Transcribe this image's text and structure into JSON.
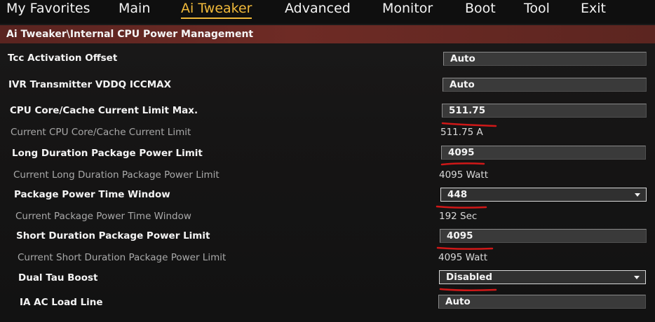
{
  "nav": {
    "items": [
      {
        "label": "My Favorites"
      },
      {
        "label": "Main"
      },
      {
        "label": "Ai Tweaker"
      },
      {
        "label": "Advanced"
      },
      {
        "label": "Monitor"
      },
      {
        "label": "Boot"
      },
      {
        "label": "Tool"
      },
      {
        "label": "Exit"
      }
    ],
    "active": "Ai Tweaker"
  },
  "breadcrumb": "Ai Tweaker\\Internal CPU Power Management",
  "settings": {
    "tcc_activation_offset": {
      "label": "Tcc Activation Offset",
      "value": "Auto"
    },
    "ivr_transmitter": {
      "label": "IVR Transmitter VDDQ ICCMAX",
      "value": "Auto"
    },
    "cpu_core_cache_limit": {
      "label": "CPU Core/Cache Current Limit Max.",
      "value": "511.75"
    },
    "current_cpu_core_cache_limit": {
      "label": "Current CPU Core/Cache Current Limit",
      "value": "511.75 A"
    },
    "long_duration_power_limit": {
      "label": "Long Duration Package Power Limit",
      "value": "4095"
    },
    "current_long_duration_power_limit": {
      "label": "Current Long Duration Package Power Limit",
      "value": "4095 Watt"
    },
    "package_power_time_window": {
      "label": "Package Power Time Window",
      "value": "448"
    },
    "current_package_power_time_window": {
      "label": "Current Package Power Time Window",
      "value": "192 Sec"
    },
    "short_duration_power_limit": {
      "label": "Short Duration Package Power Limit",
      "value": "4095"
    },
    "current_short_duration_power_limit": {
      "label": "Current Short Duration Package Power Limit",
      "value": "4095 Watt"
    },
    "dual_tau_boost": {
      "label": "Dual Tau Boost",
      "value": "Disabled"
    },
    "ia_ac_load_line": {
      "label": "IA AC Load Line",
      "value": "Auto"
    }
  },
  "colors": {
    "accent": "#f0b93a",
    "breadcrumb_bg": "#6e2b25",
    "annotation": "#d01818"
  }
}
